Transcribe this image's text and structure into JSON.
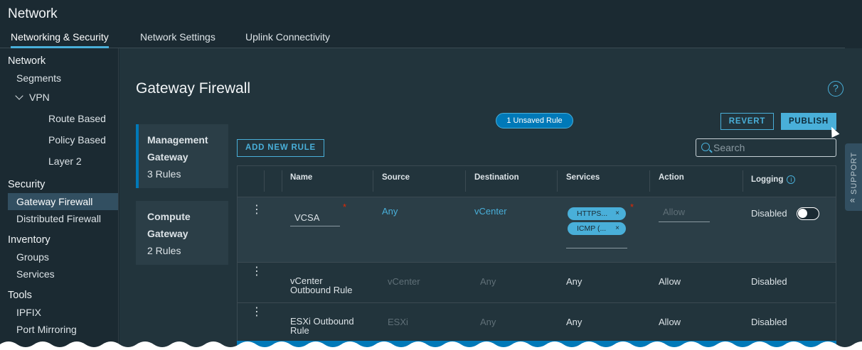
{
  "app": {
    "title": "Network"
  },
  "topnav": {
    "tabs": [
      {
        "label": "Networking & Security"
      },
      {
        "label": "Network Settings"
      },
      {
        "label": "Uplink Connectivity"
      }
    ]
  },
  "sidebar": {
    "network_header": "Network",
    "segments": "Segments",
    "vpn": "VPN",
    "route_based": "Route Based",
    "policy_based": "Policy Based",
    "layer2": "Layer 2",
    "security_header": "Security",
    "gateway_firewall": "Gateway Firewall",
    "distributed_firewall": "Distributed Firewall",
    "inventory_header": "Inventory",
    "groups": "Groups",
    "services": "Services",
    "tools_header": "Tools",
    "ipfix": "IPFIX",
    "port_mirroring": "Port Mirroring"
  },
  "main": {
    "title": "Gateway Firewall",
    "help_icon": "?",
    "unsaved_badge": "1 Unsaved Rule",
    "revert_label": "REVERT",
    "publish_label": "PUBLISH",
    "add_rule_label": "ADD NEW RULE",
    "search_placeholder": "Search"
  },
  "gateways": [
    {
      "line1": "Management",
      "line2": "Gateway",
      "count": "3 Rules"
    },
    {
      "line1": "Compute",
      "line2": "Gateway",
      "count": "2 Rules"
    }
  ],
  "table": {
    "columns": {
      "name": "Name",
      "source": "Source",
      "destination": "Destination",
      "services": "Services",
      "action": "Action",
      "logging": "Logging"
    },
    "rows": [
      {
        "name": "VCSA",
        "source": "Any",
        "destination": "vCenter",
        "services": [
          "HTTPS...",
          "ICMP (..."
        ],
        "action_placeholder": "Allow",
        "logging": "Disabled"
      },
      {
        "name_line1": "vCenter",
        "name_line2": "Outbound Rule",
        "source": "vCenter",
        "destination": "Any",
        "services": "Any",
        "action": "Allow",
        "logging": "Disabled"
      },
      {
        "name_line1": "ESXi Outbound",
        "name_line2": "Rule",
        "source": "ESXi",
        "destination": "Any",
        "services": "Any",
        "action": "Allow",
        "logging": "Disabled"
      }
    ]
  },
  "support": {
    "label": "SUPPORT"
  },
  "colors": {
    "accent": "#49afd9",
    "accent_dark": "#0079b8",
    "required": "#e62700",
    "background": "#1b2a32"
  }
}
